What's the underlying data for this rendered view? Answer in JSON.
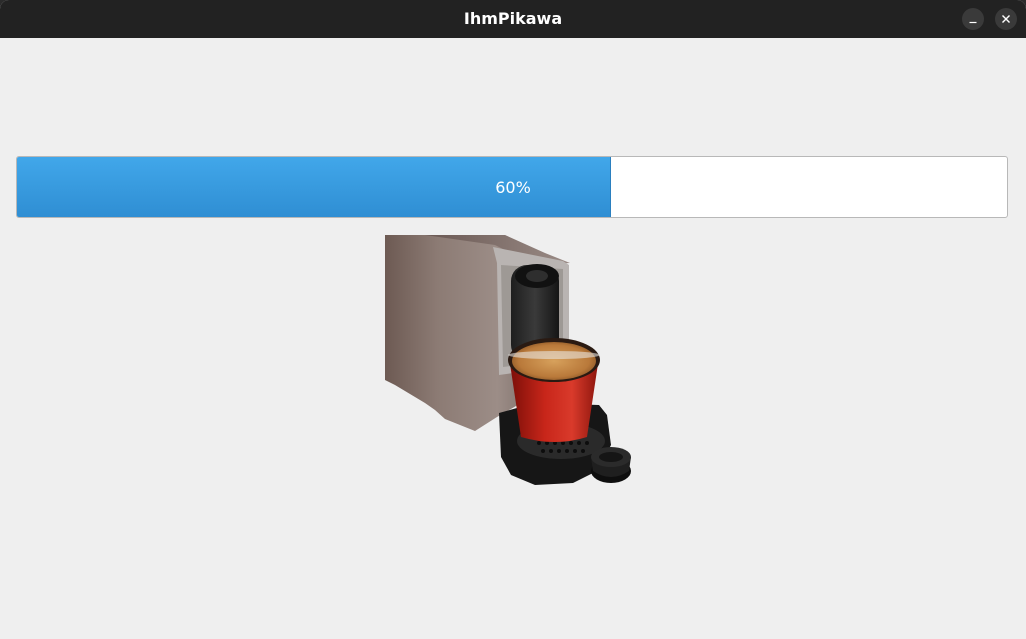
{
  "window": {
    "title": "IhmPikawa",
    "controls": [
      "minimize-icon",
      "close-icon"
    ]
  },
  "progress": {
    "percent": 60,
    "label": "60%",
    "fill_color": "#3a9fe3"
  },
  "image": {
    "subject": "coffee-machine"
  }
}
